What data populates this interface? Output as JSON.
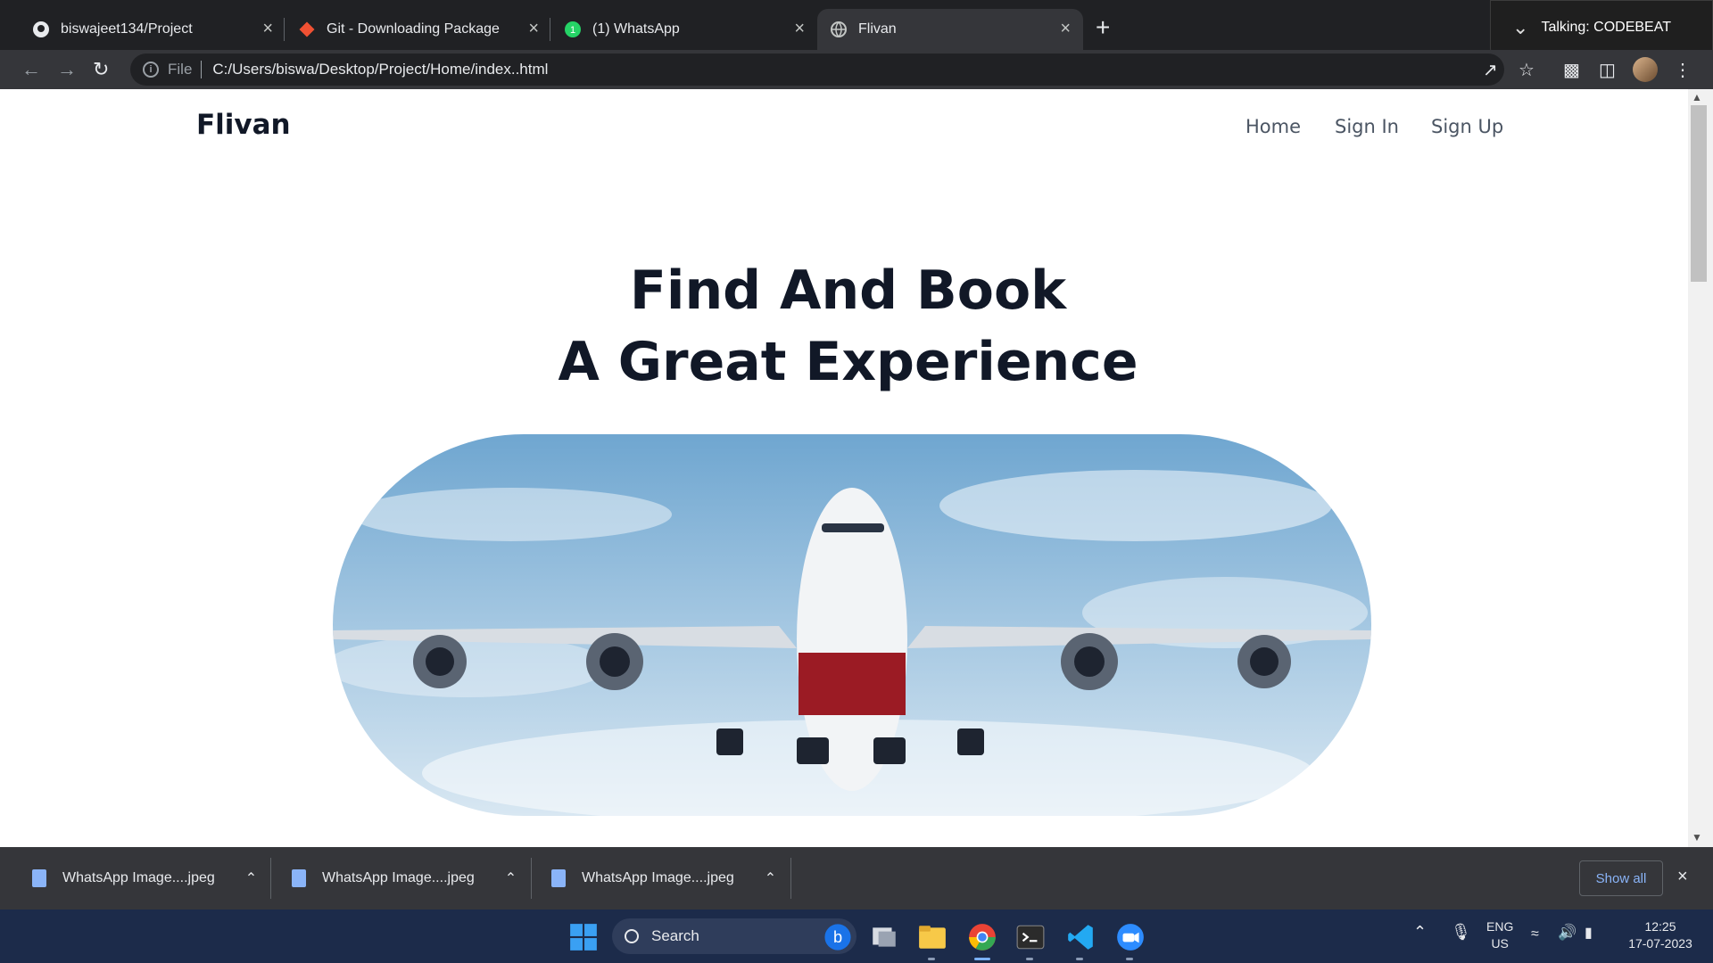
{
  "browser": {
    "tabs": [
      {
        "title": "biswajeet134/Project",
        "icon": "github-icon"
      },
      {
        "title": "Git - Downloading Package",
        "icon": "git-icon"
      },
      {
        "title": "(1) WhatsApp",
        "icon": "whatsapp-icon"
      },
      {
        "title": "Flivan",
        "icon": "globe-icon"
      }
    ],
    "close_glyph": "×",
    "new_tab_glyph": "+",
    "talking": "Talking: CODEBEAT",
    "address_prefix": "File",
    "address": "C:/Users/biswa/Desktop/Project/Home/index..html"
  },
  "site": {
    "brand": "Flivan",
    "nav": [
      "Home",
      "Sign In",
      "Sign Up"
    ],
    "hero_line1": "Find And Book",
    "hero_line2": "A Great Experience"
  },
  "downloads": {
    "items": [
      "WhatsApp Image....jpeg",
      "WhatsApp Image....jpeg",
      "WhatsApp Image....jpeg"
    ],
    "show_all": "Show all"
  },
  "taskbar": {
    "search_label": "Search",
    "lang_line1": "ENG",
    "lang_line2": "US",
    "time": "12:25",
    "date": "17-07-2023"
  },
  "colors": {
    "accent": "#8ab4f8",
    "heading": "#111827",
    "nav_text": "#4b5563"
  }
}
